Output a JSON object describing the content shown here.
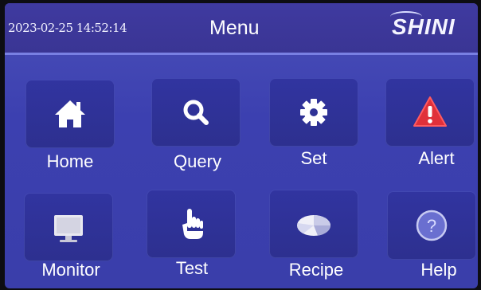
{
  "header": {
    "datetime": "2023-02-25 14:52:14",
    "title": "Menu",
    "logo": "SHINI"
  },
  "menu": [
    {
      "label": "Home",
      "icon": "home-icon"
    },
    {
      "label": "Query",
      "icon": "search-icon"
    },
    {
      "label": "Set",
      "icon": "gear-icon"
    },
    {
      "label": "Alert",
      "icon": "warning-icon"
    },
    {
      "label": "Monitor",
      "icon": "monitor-icon"
    },
    {
      "label": "Test",
      "icon": "hand-pointer-icon"
    },
    {
      "label": "Recipe",
      "icon": "pie-chart-icon"
    },
    {
      "label": "Help",
      "icon": "help-icon"
    }
  ],
  "colors": {
    "background": "#3c40b0",
    "header": "#3a3594",
    "tile": "#2f3296",
    "alert": "#e0303a"
  }
}
